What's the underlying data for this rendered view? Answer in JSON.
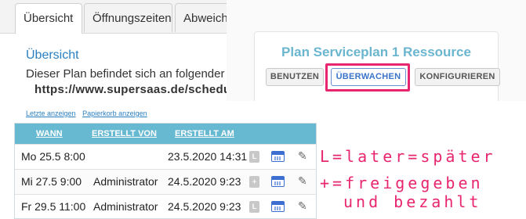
{
  "tabs": [
    "Übersicht",
    "Öffnungszeiten",
    "Abweich"
  ],
  "section_title": "Übersicht",
  "description": "Dieser Plan befindet sich an folgender We",
  "url": "https://www.supersaas.de/schedule/",
  "links": [
    "Letzte anzeigen",
    "Papierkorb anzeigen"
  ],
  "table": {
    "headers": [
      "WANN",
      "ERSTELLT VON",
      "ERSTELLT AM"
    ],
    "rows": [
      {
        "when": "Mo 25.5 8:00",
        "by": "",
        "at": "23.5.2020 14:31",
        "badge": "L"
      },
      {
        "when": "Mi 27.5 9:00",
        "by": "Administrator",
        "at": "24.5.2020 9:23",
        "badge": "+"
      },
      {
        "when": "Fr 29.5 11:00",
        "by": "Administrator",
        "at": "24.5.2020 9:23",
        "badge": "L"
      }
    ]
  },
  "panel": {
    "title": "Plan Serviceplan 1 Ressource",
    "buttons": [
      "BENUTZEN",
      "ÜBERWACHEN",
      "KONFIGURIEREN"
    ],
    "highlight_color": "#e8256f"
  },
  "annotation": [
    "L=later=später",
    "+=freigegeben",
    "und bezahlt"
  ],
  "icons": {
    "calendar": "calendar-icon",
    "edit": "edit-icon"
  }
}
